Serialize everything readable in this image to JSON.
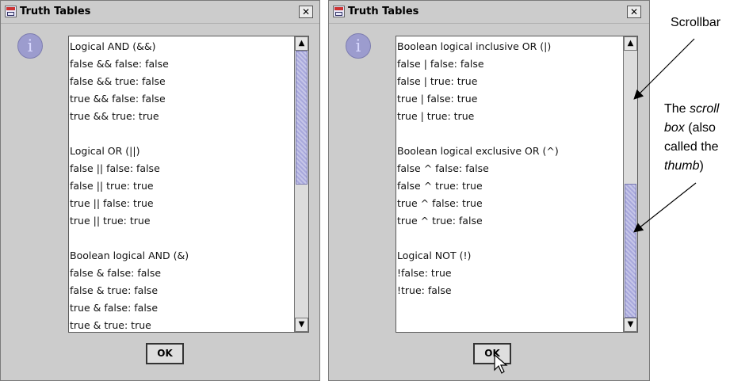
{
  "dialogs": [
    {
      "title": "Truth Tables",
      "close_label": "✕",
      "info_glyph": "i",
      "lines": [
        "Logical AND (&&)",
        "false && false: false",
        "false && true: false",
        "true && false: false",
        "true && true: true",
        "",
        "Logical OR (||)",
        "false || false: false",
        "false || true: true",
        "true || false: true",
        "true || true: true",
        "",
        "Boolean logical AND (&)",
        "false & false: false",
        "false & true: false",
        "true & false: false",
        "true & true: true"
      ],
      "ok_label": "OK",
      "scroll_position": 0,
      "thumb_fraction": 0.5
    },
    {
      "title": "Truth Tables",
      "close_label": "✕",
      "info_glyph": "i",
      "lines": [
        "Boolean logical inclusive OR (|)",
        "false | false: false",
        "false | true: true",
        "true | false: true",
        "true | true: true",
        "",
        "Boolean logical exclusive OR (^)",
        "false ^ false: false",
        "false ^ true: true",
        "true ^ false: true",
        "true ^ true: false",
        "",
        "Logical NOT (!)",
        "!false: true",
        "!true: false"
      ],
      "ok_label": "OK",
      "scroll_position": 1,
      "thumb_fraction": 0.5
    }
  ],
  "annotations": {
    "scrollbar_label": "Scrollbar",
    "scrollbox_line1_prefix": "The ",
    "scrollbox_line1_em": "scroll",
    "scrollbox_line2_em": "box",
    "scrollbox_line2_rest": " (also",
    "scrollbox_line3": "called the",
    "scrollbox_line4_em": "thumb",
    "scrollbox_line4_rest": ")"
  },
  "colors": {
    "dialog_bg": "#cccccc",
    "thumb": "#a8a8dc",
    "info_icon": "#9c9cce"
  }
}
